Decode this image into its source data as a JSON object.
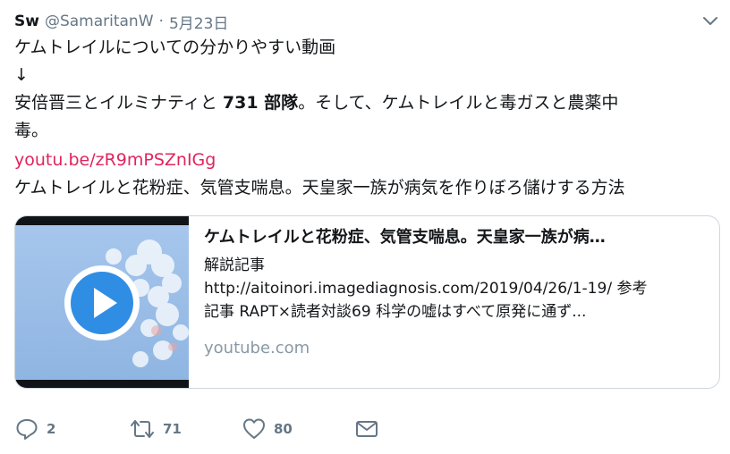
{
  "tweet": {
    "name": "Sw",
    "handle": "@SamaritanW",
    "separator": "·",
    "date": "5月23日",
    "text": {
      "line1": "ケムトレイルについての分かりやすい動画",
      "arrow": "↓",
      "line3_a": "安倍晋三とイルミナティと ",
      "line3_bold": "731 部隊",
      "line3_b": "。そして、ケムトレイルと毒ガスと農薬中",
      "line4": "毒。",
      "link": "youtu.be/zR9mPSZnIGg",
      "line6": "ケムトレイルと花粉症、気管支喘息。天皇家一族が病気を作りぼろ儲けする方法"
    },
    "card": {
      "title": "ケムトレイルと花粉症、気管支喘息。天皇家一族が病…",
      "desc1": "解説記事",
      "desc2": "http://aitoinori.imagediagnosis.com/2019/04/26/1-19/ 参考",
      "desc3": "記事 RAPT×読者対談69 科学の嘘はすべて原発に通ず...",
      "domain": "youtube.com"
    },
    "actions": {
      "replies": "2",
      "retweets": "71",
      "likes": "80"
    },
    "colors": {
      "link": "#e0245e",
      "secondary": "#657786",
      "play_button": "#2f8de4"
    }
  }
}
